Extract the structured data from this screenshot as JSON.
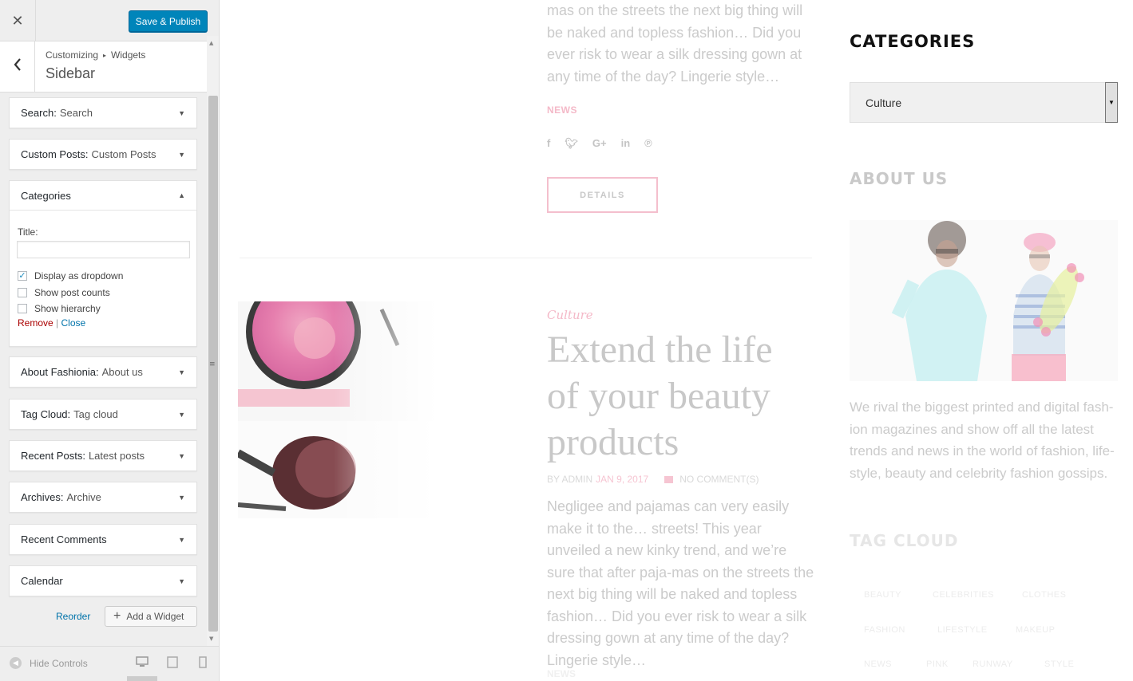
{
  "customizer": {
    "close_glyph": "✕",
    "save_label": "Save & Publish",
    "back_glyph": "‹",
    "breadcrumb": [
      "Customizing",
      "Widgets"
    ],
    "section_name": "Sidebar",
    "widgets": [
      {
        "name": "Search",
        "title": "Search"
      },
      {
        "name": "Custom Posts",
        "title": "Custom Posts"
      },
      {
        "name": "Categories",
        "title": ""
      },
      {
        "name": "About Fashionia",
        "title": "About us"
      },
      {
        "name": "Tag Cloud",
        "title": "Tag cloud"
      },
      {
        "name": "Recent Posts",
        "title": "Latest posts"
      },
      {
        "name": "Archives",
        "title": "Archive"
      },
      {
        "name": "Recent Comments",
        "title": ""
      },
      {
        "name": "Calendar",
        "title": ""
      }
    ],
    "categories_form": {
      "title_label": "Title:",
      "title_value": "",
      "options": [
        {
          "label": "Display as dropdown",
          "checked": true
        },
        {
          "label": "Show post counts",
          "checked": false
        },
        {
          "label": "Show hierarchy",
          "checked": false
        }
      ],
      "remove_label": "Remove",
      "separator": "|",
      "close_label": "Close"
    },
    "reorder_label": "Reorder",
    "add_widget_label": "Add a Widget",
    "hide_controls_label": "Hide Controls"
  },
  "preview": {
    "post1": {
      "excerpt": "mas on the streets the next big thing will be naked and topless fashion… Did you ever risk to wear a silk dressing gown at any time of the day? Lingerie style…",
      "category": "NEWS",
      "details_label": "DETAILS"
    },
    "post2": {
      "category": "Culture",
      "title": "Extend the life of your beauty products",
      "meta_by": "BY ADMIN",
      "meta_date": "JAN 9, 2017",
      "meta_comments": "NO COMMENT(S)",
      "excerpt": "Negligee and pajamas can very easily make it to the… streets! This year unveiled a new kinky trend, and we’re sure that after paja-mas on the streets the next big thing will be naked and topless fashion… Did you ever risk to wear a silk dressing gown at any time of the day? Lingerie style…",
      "category_footer": "NEWS"
    },
    "sidebar": {
      "categories_heading": "CATEGORIES",
      "categories_selected": "Culture",
      "about_heading": "ABOUT US",
      "about_text": "We rival the biggest printed and digital fash-ion magazines and show off all the latest trends and news in the world of fashion, life-style, beauty and celebrity fashion gossips.",
      "tag_heading": "TAG CLOUD",
      "tags": [
        "BEAUTY",
        "CELEBRITIES",
        "CLOTHES",
        "FASHION",
        "LIFESTYLE",
        "MAKEUP",
        "NEWS",
        "PINK",
        "RUNWAY",
        "STYLE"
      ]
    },
    "colors": {
      "accent_pink": "#f4b9c8",
      "button_blue": "#0085ba"
    }
  }
}
